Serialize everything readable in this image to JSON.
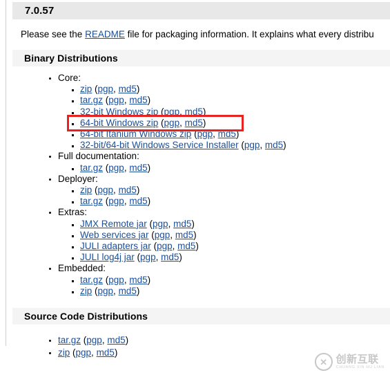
{
  "version_heading": "7.0.57",
  "intro": {
    "before_link": "Please see the ",
    "link_text": "README",
    "after_link": " file for packaging information. It explains what every distribu"
  },
  "binary": {
    "heading": "Binary Distributions",
    "groups": [
      {
        "label": "Core:",
        "items": [
          {
            "name": "zip",
            "pgp": "pgp",
            "md5": "md5"
          },
          {
            "name": "tar.gz",
            "pgp": "pgp",
            "md5": "md5"
          },
          {
            "name": "32-bit Windows zip",
            "pgp": "pgp",
            "md5": "md5"
          },
          {
            "name": "64-bit Windows zip",
            "pgp": "pgp",
            "md5": "md5",
            "highlighted": true
          },
          {
            "name": "64-bit Itanium Windows zip",
            "pgp": "pgp",
            "md5": "md5"
          },
          {
            "name": "32-bit/64-bit Windows Service Installer",
            "pgp": "pgp",
            "md5": "md5"
          }
        ]
      },
      {
        "label": "Full documentation:",
        "items": [
          {
            "name": "tar.gz",
            "pgp": "pgp",
            "md5": "md5"
          }
        ]
      },
      {
        "label": "Deployer:",
        "items": [
          {
            "name": "zip",
            "pgp": "pgp",
            "md5": "md5"
          },
          {
            "name": "tar.gz",
            "pgp": "pgp",
            "md5": "md5"
          }
        ]
      },
      {
        "label": "Extras:",
        "items": [
          {
            "name": "JMX Remote jar",
            "pgp": "pgp",
            "md5": "md5"
          },
          {
            "name": "Web services jar",
            "pgp": "pgp",
            "md5": "md5"
          },
          {
            "name": "JULI adapters jar",
            "pgp": "pgp",
            "md5": "md5"
          },
          {
            "name": "JULI log4j jar",
            "pgp": "pgp",
            "md5": "md5"
          }
        ]
      },
      {
        "label": "Embedded:",
        "items": [
          {
            "name": "tar.gz",
            "pgp": "pgp",
            "md5": "md5"
          },
          {
            "name": "zip",
            "pgp": "pgp",
            "md5": "md5"
          }
        ]
      }
    ]
  },
  "source": {
    "heading": "Source Code Distributions",
    "items": [
      {
        "name": "tar.gz",
        "pgp": "pgp",
        "md5": "md5"
      },
      {
        "name": "zip",
        "pgp": "pgp",
        "md5": "md5"
      }
    ]
  },
  "watermark": {
    "logo_glyph": "✕",
    "chinese": "创新互联",
    "pinyin": "CHUANG XIN HU LIAN"
  },
  "colors": {
    "link": "#1a4f9c",
    "highlight": "#e8231f",
    "version_band": "#e8e8e8",
    "section_band": "#f4f4f4"
  }
}
